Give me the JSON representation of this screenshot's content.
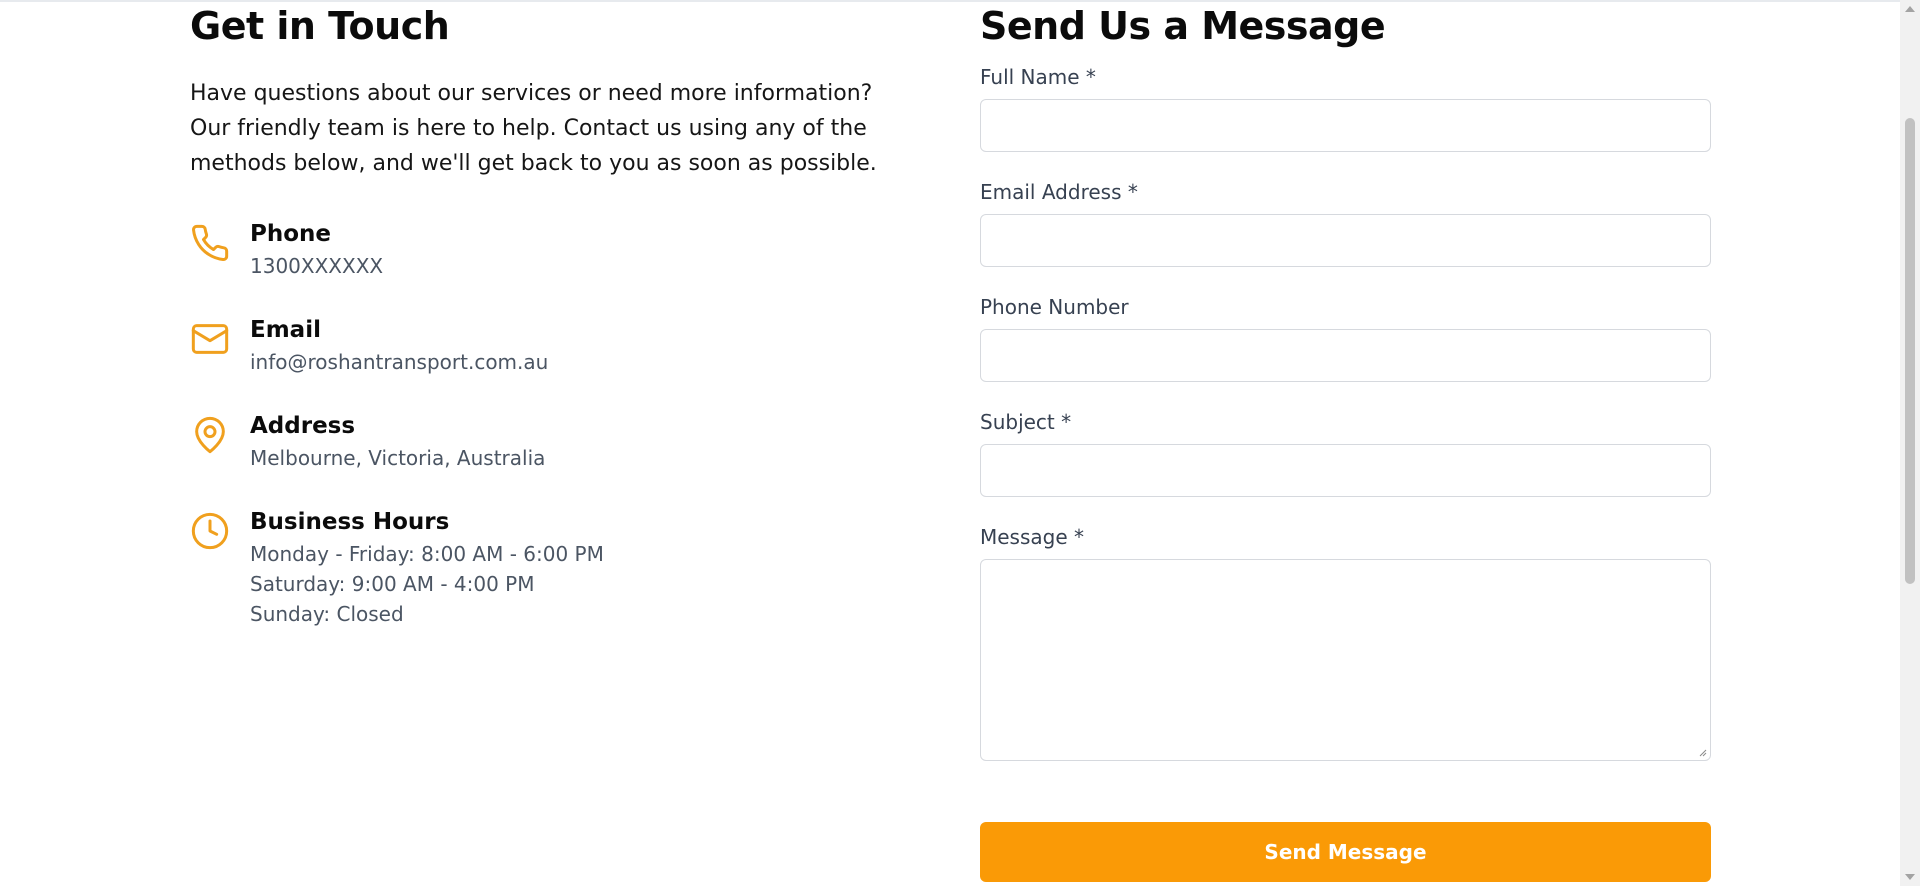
{
  "contact_info": {
    "heading": "Get in Touch",
    "intro": "Have questions about our services or need more information? Our friendly team is here to help. Contact us using any of the methods below, and we'll get back to you as soon as possible.",
    "items": [
      {
        "icon": "phone-icon",
        "title": "Phone",
        "value": "1300XXXXXX"
      },
      {
        "icon": "mail-icon",
        "title": "Email",
        "value": "info@roshantransport.com.au"
      },
      {
        "icon": "map-pin-icon",
        "title": "Address",
        "value": "Melbourne, Victoria, Australia"
      },
      {
        "icon": "clock-icon",
        "title": "Business Hours",
        "lines": [
          "Monday - Friday: 8:00 AM - 6:00 PM",
          "Saturday: 9:00 AM - 4:00 PM",
          "Sunday: Closed"
        ]
      }
    ]
  },
  "form": {
    "heading": "Send Us a Message",
    "fields": {
      "full_name": {
        "label": "Full Name *",
        "value": ""
      },
      "email": {
        "label": "Email Address *",
        "value": ""
      },
      "phone": {
        "label": "Phone Number",
        "value": ""
      },
      "subject": {
        "label": "Subject *",
        "value": ""
      },
      "message": {
        "label": "Message *",
        "value": ""
      }
    },
    "submit_label": "Send Message"
  },
  "colors": {
    "accent": "#fa9a06",
    "icon": "#f0a01e",
    "body_text": "#4b5563"
  }
}
